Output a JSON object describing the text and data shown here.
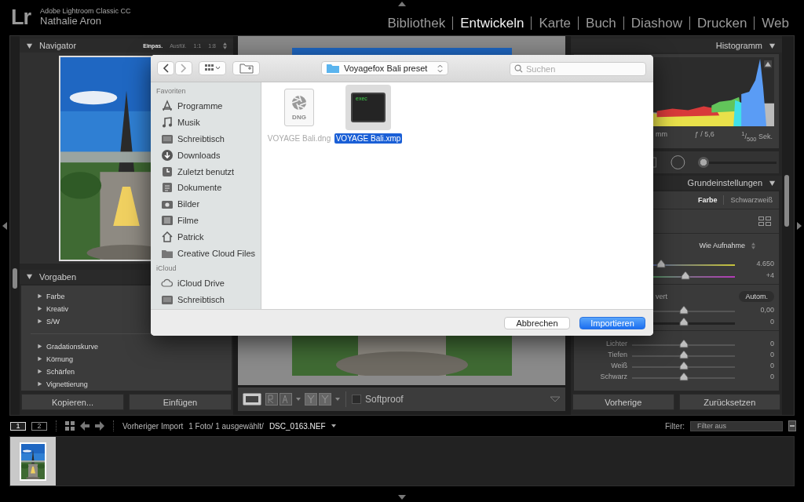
{
  "app": {
    "logo": "Lr",
    "product": "Adobe Lightroom Classic CC",
    "user": "Nathalie Aron"
  },
  "modules": [
    {
      "label": "Bibliothek",
      "selected": false
    },
    {
      "label": "Entwickeln",
      "selected": true
    },
    {
      "label": "Karte",
      "selected": false
    },
    {
      "label": "Buch",
      "selected": false
    },
    {
      "label": "Diashow",
      "selected": false
    },
    {
      "label": "Drucken",
      "selected": false
    },
    {
      "label": "Web",
      "selected": false
    }
  ],
  "navigator": {
    "title": "Navigator",
    "expanded": true,
    "zoom_options": [
      {
        "label": "Einpas.",
        "selected": true
      },
      {
        "label": "Ausfül.",
        "selected": false
      },
      {
        "label": "1:1",
        "selected": false
      },
      {
        "label": "1:8",
        "selected": false
      }
    ]
  },
  "presets": {
    "title": "Vorgaben",
    "expanded": true,
    "groups": [
      {
        "items": [
          {
            "label": "Farbe",
            "expanded": false
          },
          {
            "label": "Kreativ",
            "expanded": false
          },
          {
            "label": "S/W",
            "expanded": false
          }
        ]
      },
      {
        "items": [
          {
            "label": "Gradationskurve",
            "expanded": false
          },
          {
            "label": "Körnung",
            "expanded": false
          },
          {
            "label": "Schärfen",
            "expanded": false
          },
          {
            "label": "Vignettierung",
            "expanded": false
          }
        ]
      }
    ]
  },
  "left_buttons": [
    "Kopieren...",
    "Einfügen"
  ],
  "histogram": {
    "title": "Histogramm",
    "expanded": true,
    "info": [
      "mm",
      "ƒ / 5,6",
      "$^{1}$/$_{500}$ Sek."
    ]
  },
  "tool_slider": {
    "level": 0
  },
  "basic": {
    "title": "Grundeinstellungen",
    "expanded": true,
    "treatments": [
      {
        "label": "Farbe",
        "selected": true
      },
      {
        "label": "Schwarzweiß",
        "selected": false
      }
    ],
    "white_balance": "Wie Aufnahme",
    "wb_sliders": [
      {
        "kind": "temperature",
        "value": "4.650",
        "level": 0.28
      },
      {
        "kind": "tint",
        "value": "+4",
        "level": 0.52
      }
    ],
    "tone_label": "vert",
    "auto_button": "Autom.",
    "tone_sliders": [
      {
        "kind": "plain",
        "value": "0,00",
        "level": 0.5
      },
      {
        "kind": "dark",
        "value": "0",
        "level": 0.5
      }
    ],
    "presence_sliders": [
      {
        "kind": "plain",
        "label": "Lichter",
        "value": "0",
        "level": 0.5
      },
      {
        "kind": "plain",
        "label": "Tiefen",
        "value": "0",
        "level": 0.5
      },
      {
        "kind": "plain",
        "label": "Weiß",
        "value": "0",
        "level": 0.5
      },
      {
        "kind": "plain",
        "label": "Schwarz",
        "value": "0",
        "level": 0.5
      }
    ]
  },
  "right_buttons": [
    "Vorherige",
    "Zurücksetzen"
  ],
  "toolbar": {
    "softproof": {
      "label": "Softproof",
      "checked": false
    }
  },
  "filmstrip_bar": {
    "views": [
      {
        "label": "1",
        "selected": true
      },
      {
        "label": "2",
        "selected": false
      }
    ],
    "source": "Vorheriger Import",
    "count": "1 Foto/ 1 ausgewählt/",
    "file": "DSC_0163.NEF",
    "filter_label": "Filter:",
    "filter": "Filter aus"
  },
  "filmstrip": [
    {
      "kind": "picture",
      "selected": true
    }
  ],
  "dialog": {
    "location": "Voyagefox Bali preset",
    "search_placeholder": "Suchen",
    "sidebar": [
      {
        "heading": "Favoriten",
        "items": [
          {
            "label": "Programme",
            "kind": "apps"
          },
          {
            "label": "Musik",
            "kind": "music"
          },
          {
            "label": "Schreibtisch",
            "kind": "desktop"
          },
          {
            "label": "Downloads",
            "kind": "downloads"
          },
          {
            "label": "Zuletzt benutzt",
            "kind": "recents"
          },
          {
            "label": "Dokumente",
            "kind": "documents"
          },
          {
            "label": "Bilder",
            "kind": "pictures"
          },
          {
            "label": "Filme",
            "kind": "movies"
          },
          {
            "label": "Patrick",
            "kind": "home"
          },
          {
            "label": "Creative Cloud Files",
            "kind": "folder"
          }
        ]
      },
      {
        "heading": "iCloud",
        "items": [
          {
            "label": "iCloud Drive",
            "kind": "cloud"
          },
          {
            "label": "Schreibtisch",
            "kind": "desktop"
          }
        ]
      }
    ],
    "files": [
      {
        "name": "VOYAGE Bali.dng",
        "kind": "dng",
        "badge": "DNG",
        "disabled": true,
        "selected": false
      },
      {
        "name": "VOYAGE Bali.xmp",
        "kind": "exec",
        "badge": "exec",
        "disabled": false,
        "selected": true
      }
    ],
    "buttons": [
      {
        "label": "Abbrechen",
        "default": false
      },
      {
        "label": "Importieren",
        "default": true
      }
    ]
  }
}
